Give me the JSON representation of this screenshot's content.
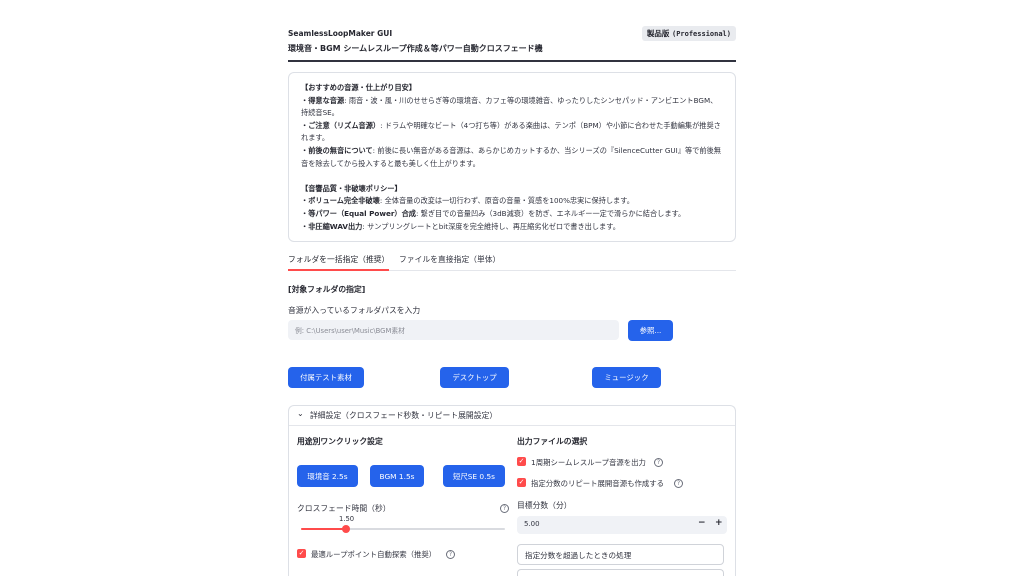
{
  "header": {
    "app_name": "SeamlessLoopMaker GUI",
    "subtitle": "環境音・BGM シームレスループ作成＆等パワー自動クロスフェード機",
    "edition_label": "製品版",
    "edition_tag": "(Professional)"
  },
  "info": {
    "title1": "【おすすめの音源・仕上がり目安】",
    "l1_bold": "・得意な音源",
    "l1_text": ": 雨音・波・風・川のせせらぎ等の環境音、カフェ等の環境雑音、ゆったりしたシンセパッド・アンビエントBGM、持続音SE。",
    "l2_bold": "・ご注意（リズム音源）",
    "l2_text": ": ドラムや明確なビート（4つ打ち等）がある楽曲は、テンポ（BPM）や小節に合わせた手動編集が推奨されます。",
    "l3_bold": "・前後の無音について",
    "l3_text": ": 前後に長い無音がある音源は、あらかじめカットするか、当シリーズの『SilenceCutter GUI』等で前後無音を除去してから投入すると最も美しく仕上がります。",
    "title2": "【音響品質・非破壊ポリシー】",
    "p1_bold": "・ボリューム完全非破壊",
    "p1_text": ": 全体音量の改変は一切行わず、原音の音量・質感を100%忠実に保持します。",
    "p2_bold": "・等パワー（Equal Power）合成",
    "p2_text": ": 繋ぎ目での音量凹み（3dB減衰）を防ぎ、エネルギー一定で滑らかに結合します。",
    "p3_bold": "・非圧縮WAV出力",
    "p3_text": ": サンプリングレートとbit深度を完全維持し、再圧縮劣化ゼロで書き出します。"
  },
  "tabs": {
    "folder": "フォルダを一括指定（推奨）",
    "file": "ファイルを直接指定（単体）"
  },
  "folder_section": {
    "title": "[対象フォルダの指定]",
    "input_label": "音源が入っているフォルダパスを入力",
    "input_placeholder": "例: C:\\Users\\user\\Music\\BGM素材",
    "browse_button": "参照..."
  },
  "shortcuts": {
    "sample": "付属テスト素材",
    "desktop": "デスクトップ",
    "music": "ミュージック"
  },
  "advanced": {
    "title": "詳細設定（クロスフェード秒数・リピート展開設定）",
    "preset_title": "用途別ワンクリック設定",
    "preset_env": "環境音 2.5s",
    "preset_bgm": "BGM 1.5s",
    "preset_se": "短尺SE 0.5s",
    "crossfade_label": "クロスフェード時間（秒）",
    "crossfade_value": "1.50",
    "crossfade_fraction": 0.22,
    "auto_search_label": "最適ループポイント自動探索（推奨）",
    "output_title": "出力ファイルの選択",
    "out1_label": "1周期シームレスループ音源を出力",
    "out2_label": "指定分数のリピート展開音源も作成する",
    "target_label": "目標分数（分）",
    "target_value": "5.00",
    "minus": "−",
    "plus": "+",
    "exceed_label": "指定分数を超過したときの処理"
  },
  "colors": {
    "accent": "#ff4b4b",
    "primary_button": "#2563eb"
  }
}
